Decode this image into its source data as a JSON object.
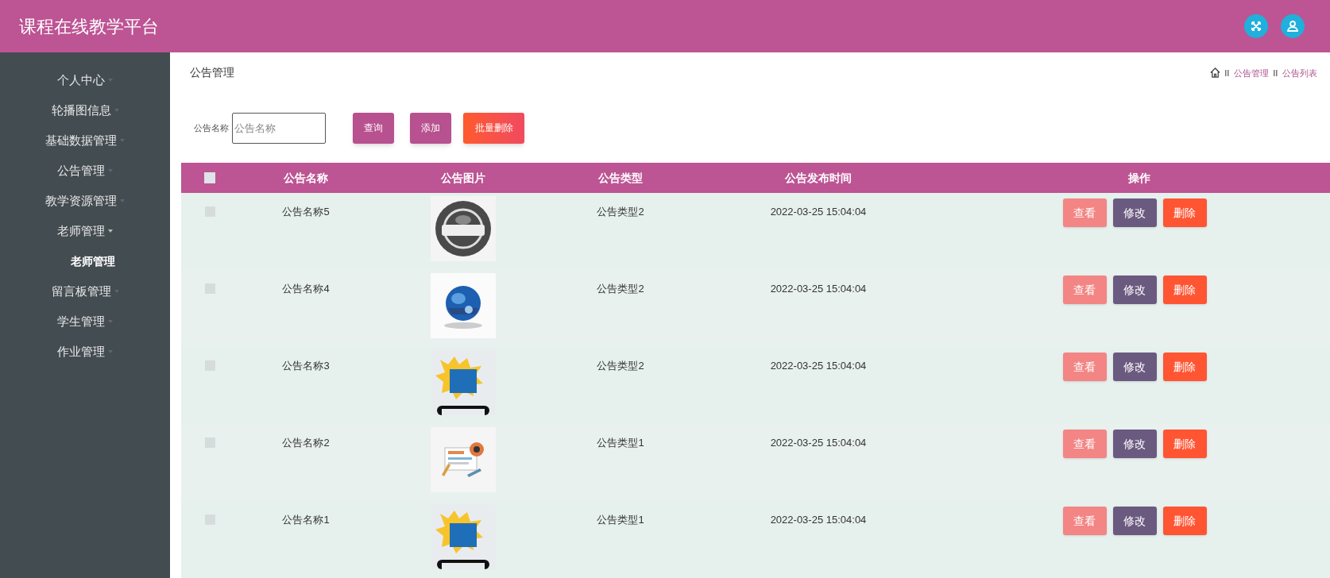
{
  "header": {
    "title": "课程在线教学平台"
  },
  "sidebar": {
    "items": [
      {
        "label": "个人中心",
        "expanded": false
      },
      {
        "label": "轮播图信息",
        "expanded": false
      },
      {
        "label": "基础数据管理",
        "expanded": false
      },
      {
        "label": "公告管理",
        "expanded": false
      },
      {
        "label": "教学资源管理",
        "expanded": false
      },
      {
        "label": "老师管理",
        "expanded": true,
        "children": [
          {
            "label": "老师管理"
          }
        ]
      },
      {
        "label": "留言板管理",
        "expanded": false
      },
      {
        "label": "学生管理",
        "expanded": false
      },
      {
        "label": "作业管理",
        "expanded": false
      }
    ]
  },
  "page_title": "公告管理",
  "breadcrumb": [
    "公告管理",
    "公告列表"
  ],
  "search": {
    "label": "公告名称",
    "placeholder": "公告名称"
  },
  "toolbar_buttons": [
    {
      "label": "查询",
      "kind": "primary"
    },
    {
      "label": "添加",
      "kind": "primary"
    },
    {
      "label": "批量删除",
      "kind": "danger"
    }
  ],
  "table": {
    "columns": [
      "公告名称",
      "公告图片",
      "公告类型",
      "公告发布时间",
      "操作"
    ],
    "select_all_checked": false,
    "rows": [
      {
        "checked": false,
        "name": "公告名称5",
        "type": "公告类型2",
        "time": "2022-03-25 15:04:04",
        "actions": [
          "查看",
          "修改",
          "删除"
        ]
      },
      {
        "checked": false,
        "name": "公告名称4",
        "type": "公告类型2",
        "time": "2022-03-25 15:04:04",
        "actions": [
          "查看",
          "修改",
          "删除"
        ]
      },
      {
        "checked": false,
        "name": "公告名称3",
        "type": "公告类型2",
        "time": "2022-03-25 15:04:04",
        "actions": [
          "查看",
          "修改",
          "删除"
        ]
      },
      {
        "checked": false,
        "name": "公告名称2",
        "type": "公告类型1",
        "time": "2022-03-25 15:04:04",
        "actions": [
          "查看",
          "修改",
          "删除"
        ]
      },
      {
        "checked": false,
        "name": "公告名称1",
        "type": "公告类型1",
        "time": "2022-03-25 15:04:04",
        "actions": [
          "查看",
          "修改",
          "删除"
        ]
      }
    ]
  }
}
